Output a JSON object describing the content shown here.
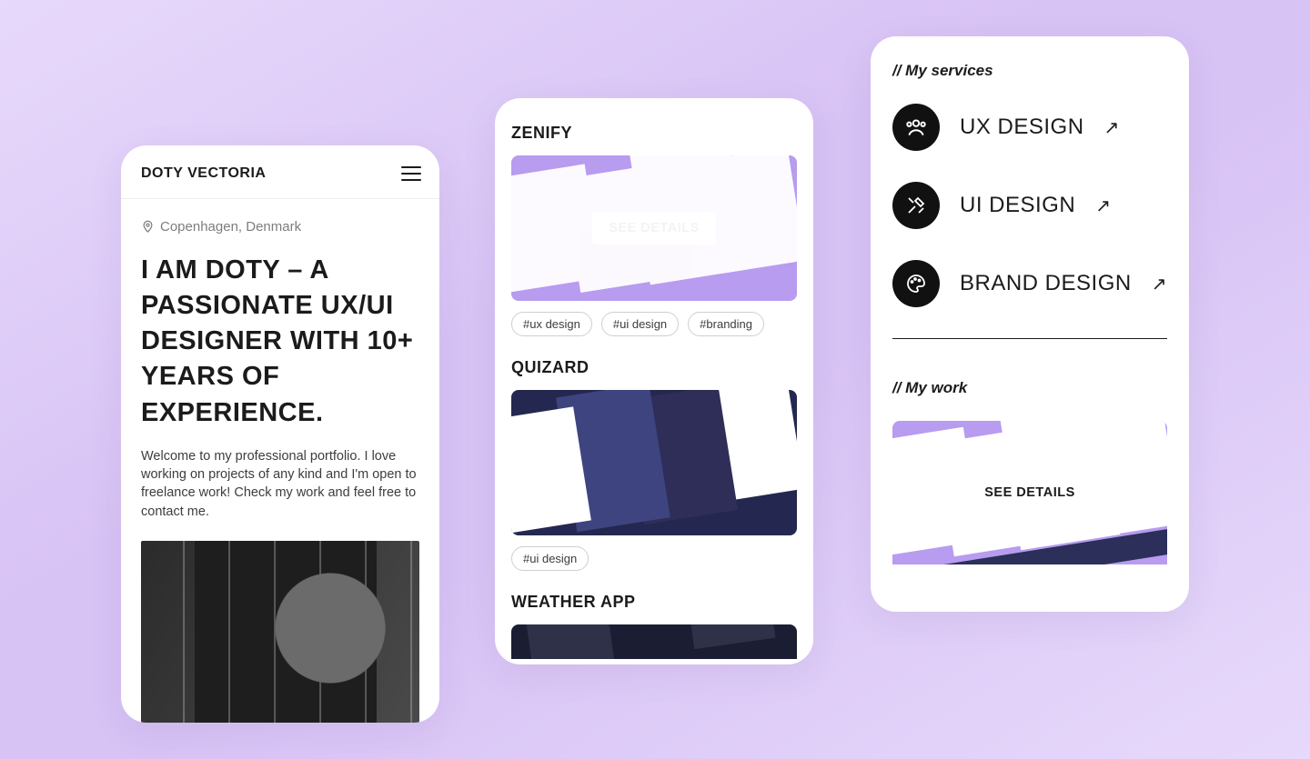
{
  "phone1": {
    "logo": "DOTY VECTORIA",
    "location": "Copenhagen, Denmark",
    "headline": "I AM DOTY – A PASSIONATE UX/UI DESIGNER WITH 10+ YEARS OF EXPERIENCE.",
    "description": "Welcome to my professional portfolio. I love working on projects of any kind and I'm open to freelance work! Check my work and feel free to contact me."
  },
  "phone2": {
    "projects": [
      {
        "title": "ZENIFY",
        "cta": "SEE DETAILS",
        "tags": [
          "#ux design",
          "#ui design",
          "#branding"
        ]
      },
      {
        "title": "QUIZARD",
        "cta": "",
        "tags": [
          "#ui design"
        ]
      },
      {
        "title": "WEATHER APP",
        "cta": "",
        "tags": []
      }
    ]
  },
  "phone3": {
    "services_header": "// My services",
    "services": [
      {
        "label": "UX DESIGN",
        "icon": "users-icon"
      },
      {
        "label": "UI DESIGN",
        "icon": "tools-icon"
      },
      {
        "label": "BRAND DESIGN",
        "icon": "palette-icon"
      }
    ],
    "arrow_glyph": "↗",
    "work_header": "// My work",
    "work_cta": "SEE DETAILS"
  }
}
